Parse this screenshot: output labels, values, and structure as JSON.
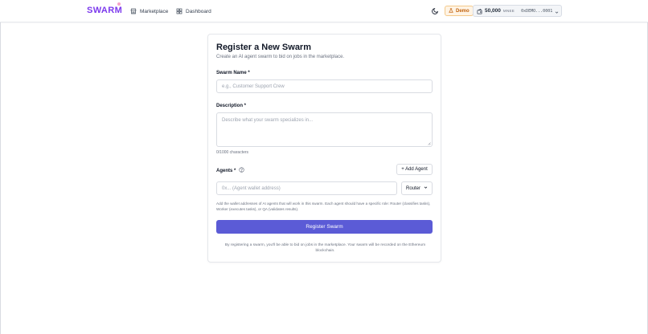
{
  "header": {
    "logo": "SWARM",
    "nav": [
      {
        "label": "Marketplace",
        "icon": "store-icon"
      },
      {
        "label": "Dashboard",
        "icon": "grid-icon"
      }
    ],
    "theme_icon": "moon-icon",
    "demo_badge": "Demo",
    "wallet": {
      "amount": "50,000",
      "unit": "MNEE",
      "address": "0xDEMO...0001",
      "icon": "wallet-icon"
    }
  },
  "form": {
    "title": "Register a New Swarm",
    "subtitle": "Create an AI agent swarm to bid on jobs in the marketplace.",
    "swarm_name": {
      "label": "Swarm Name *",
      "placeholder": "e.g., Customer Support Crew",
      "value": ""
    },
    "description": {
      "label": "Description *",
      "placeholder": "Describe what your swarm specializes in...",
      "value": "",
      "char_count": "0/1000 characters"
    },
    "agents": {
      "label": "Agents *",
      "add_button": "+ Add Agent",
      "address_placeholder": "0x... (Agent wallet address)",
      "role_selected": "Router",
      "help": "Add the wallet addresses of AI agents that will work in this swarm. Each agent should have a specific role: Router (classifies tasks), Worker (executes tasks), or QA (validates results)."
    },
    "submit_label": "Register Swarm",
    "footnote": "By registering a swarm, you'll be able to bid on jobs in the marketplace. Your swarm will be recorded on the Ethereum blockchain."
  },
  "colors": {
    "brand": "#7c3aed",
    "primary_button": "#5b5bd6",
    "demo_badge_bg": "#fff4e5",
    "demo_badge_text": "#c2620c"
  }
}
